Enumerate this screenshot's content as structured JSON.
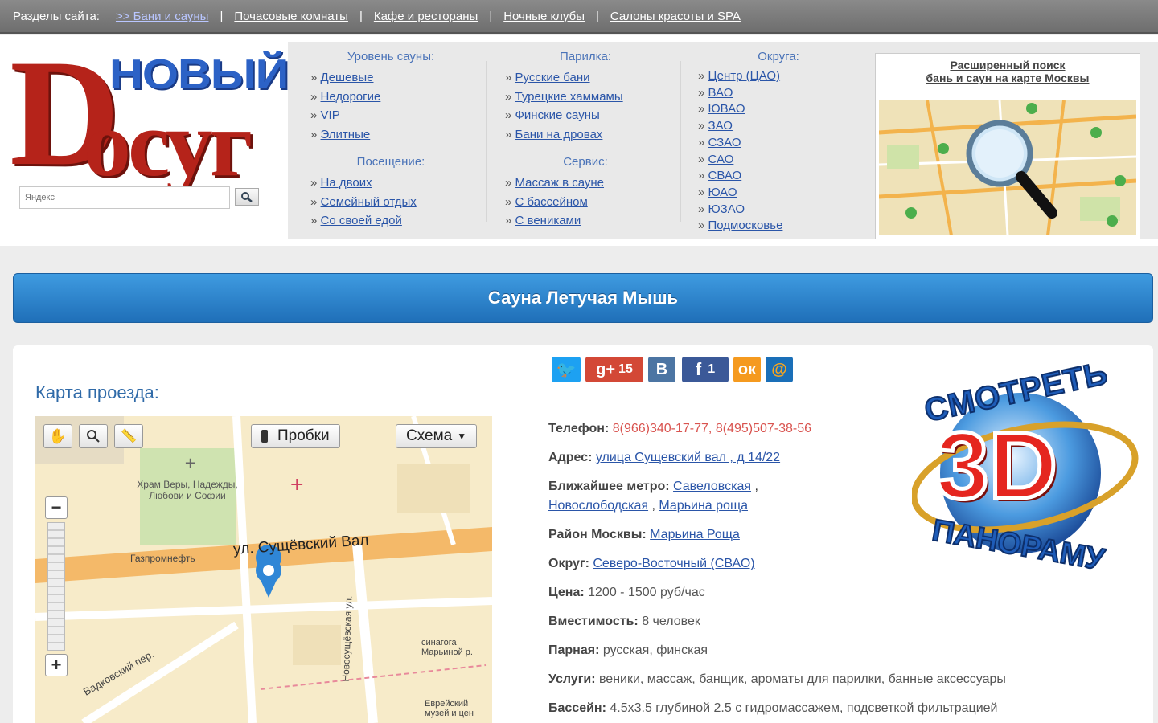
{
  "topbar": {
    "label": "Разделы сайта:",
    "links": [
      ">> Бани и сауны",
      "Почасовые комнаты",
      "Кафе и рестораны",
      "Ночные клубы",
      "Салоны красоты и SPA"
    ]
  },
  "logo": {
    "word1": "новый",
    "word2_first": "D",
    "word2_rest": "осуг"
  },
  "search": {
    "placeholder": "Яндекс"
  },
  "menu": {
    "level": {
      "title": "Уровень сауны:",
      "items": [
        "Дешевые",
        "Недорогие",
        "VIP",
        "Элитные"
      ]
    },
    "visit": {
      "title": "Посещение:",
      "items": [
        "На двоих",
        "Семейный отдых",
        "Со своей едой"
      ]
    },
    "steam": {
      "title": "Парилка:",
      "items": [
        "Русские бани",
        "Турецкие хаммамы",
        "Финские сауны",
        "Бани на дровах"
      ]
    },
    "service": {
      "title": "Сервис:",
      "items": [
        "Массаж в сауне",
        "С бассейном",
        "С вениками"
      ]
    },
    "districts": {
      "title": "Округа:",
      "items": [
        "Центр (ЦАО)",
        "ВАО",
        "ЮВАО",
        "ЗАО",
        "СЗАО",
        "САО",
        "СВАО",
        "ЮАО",
        "ЮЗАО",
        "Подмосковье"
      ]
    }
  },
  "mapsearch": {
    "line1": "Расширенный поиск",
    "line2": "бань и саун на карте Москвы"
  },
  "title": "Сауна Летучая Мышь",
  "map": {
    "label": "Карта проезда:",
    "traffic": "Пробки",
    "scheme": "Схема",
    "street": "ул. Сущёвский Вал",
    "places": [
      "Храм Веры, Надежды, Любови и Софии",
      "Газпромнефть",
      "Вадковский пер.",
      "Новосущёвская ул.",
      "синагога Марьиной р.",
      "Еврейский музей и цен"
    ]
  },
  "share": {
    "gplus_count": "15",
    "fb_count": "1"
  },
  "info": {
    "phone_label": "Телефон:",
    "phone": "8(966)340-17-77, 8(495)507-38-56",
    "address_label": "Адрес:",
    "address": "улица Сущевский вал , д 14/22",
    "metro_label": "Ближайшее метро:",
    "metro1": "Савеловская",
    "metro2": "Новослободская",
    "metro3": "Марьина роща",
    "district_label": "Район Москвы:",
    "district": "Марьина Роща",
    "okrug_label": "Округ:",
    "okrug": "Северо-Восточный (СВАО)",
    "price_label": "Цена:",
    "price": "1200 - 1500 руб/час",
    "capacity_label": "Вместимость:",
    "capacity": "8 человек",
    "steam_label": "Парная:",
    "steam": "русская, финская",
    "services_label": "Услуги:",
    "services": "веники, массаж, банщик, ароматы для парилки, банные аксессуары",
    "pool_label": "Бассейн:",
    "pool": "4.5х3.5 глубиной 2.5 с гидромассажем, подсветкой фильтрацией"
  },
  "panorama": {
    "top": "СМОТРЕТЬ",
    "mid": "3D",
    "bottom": "ПАНОРАМУ"
  },
  "colors": {
    "accent_blue": "#2f86d6",
    "logo_red": "#b5231a",
    "phone_red": "#d9534f"
  }
}
